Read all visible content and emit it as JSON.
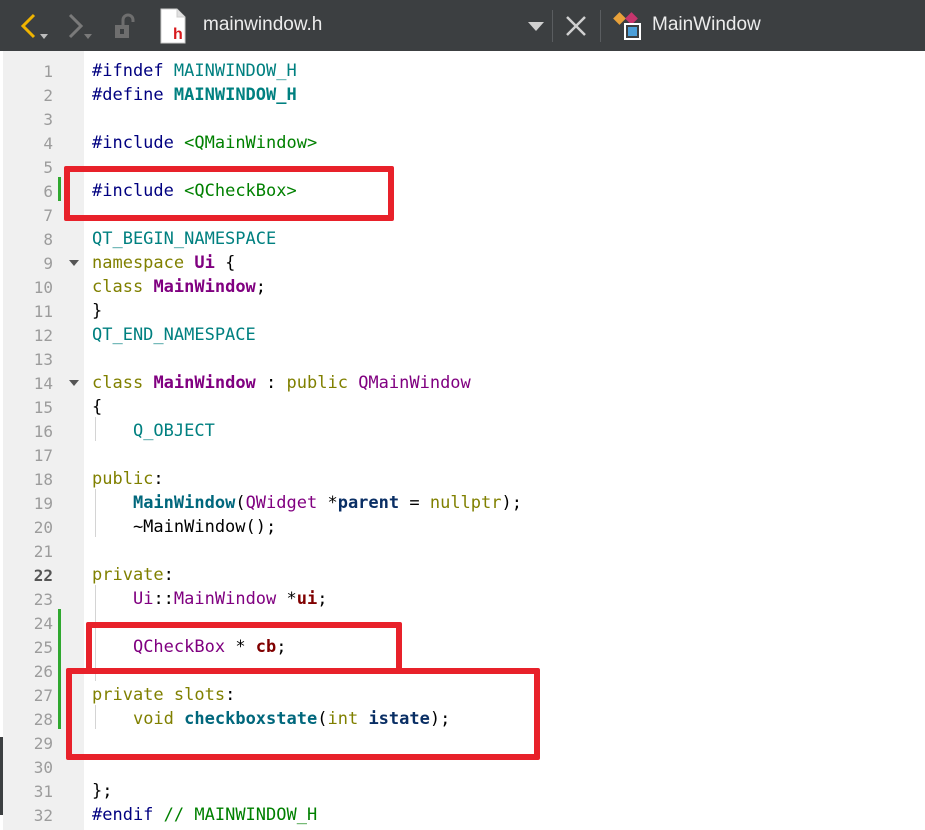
{
  "toolbar": {
    "filename": "mainwindow.h",
    "file_icon_letter": "h",
    "classname": "MainWindow",
    "icons": [
      "back-icon",
      "forward-icon",
      "lock-icon",
      "header-file-icon",
      "dropdown-icon",
      "close-icon",
      "class-icon"
    ]
  },
  "lines": [
    {
      "n": "1",
      "t": "#ifndef MAINWINDOW_H"
    },
    {
      "n": "2",
      "t": "#define MAINWINDOW_H"
    },
    {
      "n": "3",
      "t": ""
    },
    {
      "n": "4",
      "t": "#include <QMainWindow>"
    },
    {
      "n": "5",
      "t": ""
    },
    {
      "n": "6",
      "t": "#include <QCheckBox>"
    },
    {
      "n": "7",
      "t": ""
    },
    {
      "n": "8",
      "t": "QT_BEGIN_NAMESPACE"
    },
    {
      "n": "9",
      "t": "namespace Ui {"
    },
    {
      "n": "10",
      "t": "class MainWindow;"
    },
    {
      "n": "11",
      "t": "}"
    },
    {
      "n": "12",
      "t": "QT_END_NAMESPACE"
    },
    {
      "n": "13",
      "t": ""
    },
    {
      "n": "14",
      "t": "class MainWindow : public QMainWindow"
    },
    {
      "n": "15",
      "t": "{"
    },
    {
      "n": "16",
      "t": "    Q_OBJECT"
    },
    {
      "n": "17",
      "t": ""
    },
    {
      "n": "18",
      "t": "public:"
    },
    {
      "n": "19",
      "t": "    MainWindow(QWidget *parent = nullptr);"
    },
    {
      "n": "20",
      "t": "    ~MainWindow();"
    },
    {
      "n": "21",
      "t": ""
    },
    {
      "n": "22",
      "t": "private:"
    },
    {
      "n": "23",
      "t": "    Ui::MainWindow *ui;"
    },
    {
      "n": "24",
      "t": ""
    },
    {
      "n": "25",
      "t": "    QCheckBox * cb;"
    },
    {
      "n": "26",
      "t": ""
    },
    {
      "n": "27",
      "t": "private slots:"
    },
    {
      "n": "28",
      "t": "    void checkboxstate(int istate);"
    },
    {
      "n": "29",
      "t": ""
    },
    {
      "n": "30",
      "t": ""
    },
    {
      "n": "31",
      "t": "};"
    },
    {
      "n": "32",
      "t": "#endif // MAINWINDOW_H"
    }
  ],
  "current_line": "22",
  "colors": {
    "toolbar_bg": "#3c3f41",
    "gutter_bg": "#f0f0f0",
    "highlight": "#e8212a",
    "modified_marker": "#2fa82f",
    "back_icon": "#f0b400"
  }
}
